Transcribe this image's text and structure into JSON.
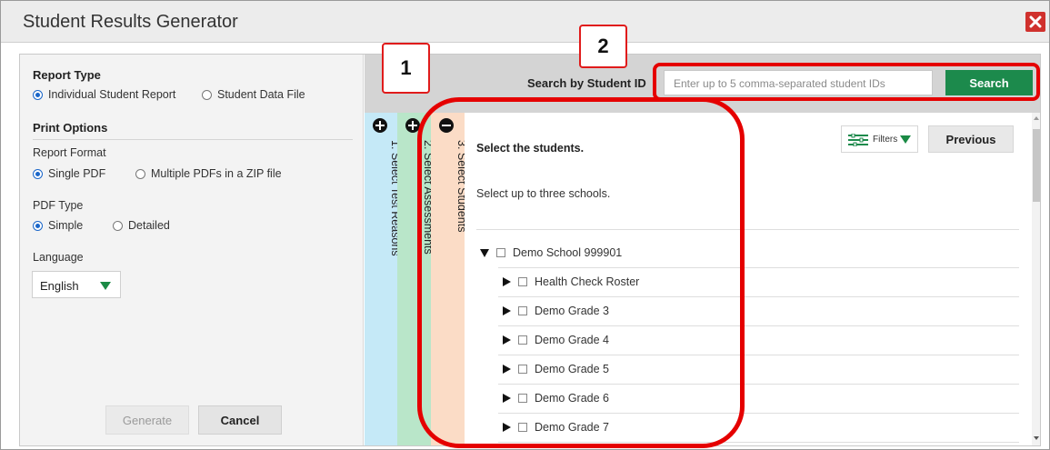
{
  "window": {
    "title": "Student Results Generator"
  },
  "left": {
    "report_type_heading": "Report Type",
    "report_type_options": [
      "Individual Student Report",
      "Student Data File"
    ],
    "print_options_heading": "Print Options",
    "report_format_label": "Report Format",
    "report_format_options": [
      "Single PDF",
      "Multiple PDFs in a ZIP file"
    ],
    "pdf_type_label": "PDF Type",
    "pdf_type_options": [
      "Simple",
      "Detailed"
    ],
    "language_label": "Language",
    "language_value": "English",
    "generate_label": "Generate",
    "cancel_label": "Cancel"
  },
  "search": {
    "label": "Search by Student ID",
    "placeholder": "Enter up to 5 comma-separated student IDs",
    "button_label": "Search"
  },
  "steps": [
    "1. Select Test Reasons",
    "2. Select Assessments",
    "3. Select Students"
  ],
  "main": {
    "heading": "Select the students.",
    "filters_label": "Filters",
    "previous_label": "Previous",
    "instruction": "Select up to three schools.",
    "school": "Demo School 999901",
    "children": [
      "Health Check Roster",
      "Demo Grade 3",
      "Demo Grade 4",
      "Demo Grade 5",
      "Demo Grade 6",
      "Demo Grade 7"
    ]
  },
  "callouts": [
    "1",
    "2"
  ],
  "colors": {
    "accent_green": "#1c8a4c",
    "annotation_red": "#e50000",
    "close_red": "#d0312d"
  }
}
